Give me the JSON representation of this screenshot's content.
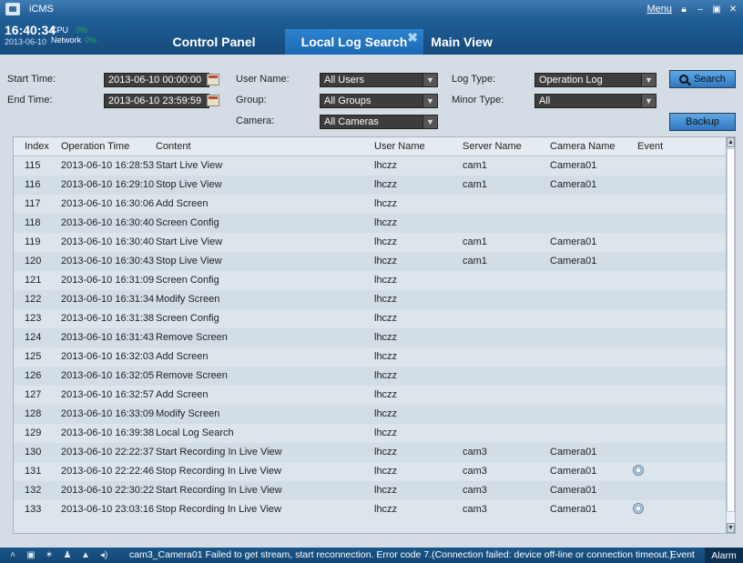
{
  "app": {
    "title": "iCMS",
    "menu_label": "Menu"
  },
  "window_buttons": [
    "lock-icon",
    "minimize-icon",
    "restore-icon",
    "close-icon"
  ],
  "header": {
    "time": "16:40:34",
    "date": "2013-06-10",
    "cpu_label": "CPU",
    "cpu_value": "0%",
    "network_label": "Network",
    "network_value": "0%"
  },
  "tabs": [
    {
      "label": "Control Panel",
      "active": false
    },
    {
      "label": "Local Log Search",
      "active": true
    },
    {
      "label": "Main View",
      "active": false
    }
  ],
  "search": {
    "start_time_label": "Start Time:",
    "start_time": "2013-06-10 00:00:00",
    "end_time_label": "End Time:",
    "end_time": "2013-06-10 23:59:59",
    "user_name_label": "User Name:",
    "user_name_value": "All Users",
    "group_label": "Group:",
    "group_value": "All Groups",
    "camera_label": "Camera:",
    "camera_value": "All Cameras",
    "log_type_label": "Log Type:",
    "log_type_value": "Operation Log",
    "minor_type_label": "Minor Type:",
    "minor_type_value": "All",
    "search_button": "Search",
    "backup_button": "Backup"
  },
  "table": {
    "columns": [
      "Index",
      "Operation Time",
      "Content",
      "User Name",
      "Server Name",
      "Camera Name",
      "Event"
    ],
    "rows": [
      [
        "115",
        "2013-06-10 16:28:53",
        "Start Live View",
        "lhczz",
        "cam1",
        "Camera01",
        ""
      ],
      [
        "116",
        "2013-06-10 16:29:10",
        "Stop Live View",
        "lhczz",
        "cam1",
        "Camera01",
        ""
      ],
      [
        "117",
        "2013-06-10 16:30:06",
        "Add Screen",
        "lhczz",
        "",
        "",
        ""
      ],
      [
        "118",
        "2013-06-10 16:30:40",
        "Screen Config",
        "lhczz",
        "",
        "",
        ""
      ],
      [
        "119",
        "2013-06-10 16:30:40",
        "Start Live View",
        "lhczz",
        "cam1",
        "Camera01",
        ""
      ],
      [
        "120",
        "2013-06-10 16:30:43",
        "Stop Live View",
        "lhczz",
        "cam1",
        "Camera01",
        ""
      ],
      [
        "121",
        "2013-06-10 16:31:09",
        "Screen Config",
        "lhczz",
        "",
        "",
        ""
      ],
      [
        "122",
        "2013-06-10 16:31:34",
        "Modify Screen",
        "lhczz",
        "",
        "",
        ""
      ],
      [
        "123",
        "2013-06-10 16:31:38",
        "Screen Config",
        "lhczz",
        "",
        "",
        ""
      ],
      [
        "124",
        "2013-06-10 16:31:43",
        "Remove Screen",
        "lhczz",
        "",
        "",
        ""
      ],
      [
        "125",
        "2013-06-10 16:32:03",
        "Add Screen",
        "lhczz",
        "",
        "",
        ""
      ],
      [
        "126",
        "2013-06-10 16:32:05",
        "Remove Screen",
        "lhczz",
        "",
        "",
        ""
      ],
      [
        "127",
        "2013-06-10 16:32:57",
        "Add Screen",
        "lhczz",
        "",
        "",
        ""
      ],
      [
        "128",
        "2013-06-10 16:33:09",
        "Modify Screen",
        "lhczz",
        "",
        "",
        ""
      ],
      [
        "129",
        "2013-06-10 16:39:38",
        "Local Log Search",
        "lhczz",
        "",
        "",
        ""
      ],
      [
        "130",
        "2013-06-10 22:22:37",
        "Start Recording In Live View",
        "lhczz",
        "cam3",
        "Camera01",
        ""
      ],
      [
        "131",
        "2013-06-10 22:22:46",
        "Stop Recording In Live View",
        "lhczz",
        "cam3",
        "Camera01",
        "event-icon"
      ],
      [
        "132",
        "2013-06-10 22:30:22",
        "Start Recording In Live View",
        "lhczz",
        "cam3",
        "Camera01",
        ""
      ],
      [
        "133",
        "2013-06-10 23:03:16",
        "Stop Recording In Live View",
        "lhczz",
        "cam3",
        "Camera01",
        "event-icon"
      ]
    ]
  },
  "statusbar": {
    "message": "cam3_Camera01 Failed to get stream, start reconnection. Error code 7.(Connection failed: device off-line or connection timeout.)",
    "event_label": "Event",
    "alarm_label": "Alarm",
    "icons": [
      "expand-icon",
      "monitor-icon",
      "pin-icon",
      "user-icon",
      "alert-icon",
      "speaker-icon"
    ]
  },
  "colors": {
    "titlebar": "#2f6aa3",
    "header": "#1a5487",
    "active_tab": "#2577c2",
    "panel": "#d4dde6",
    "button_accent": "#3f8bd3",
    "status_ok": "#2aa84a"
  }
}
